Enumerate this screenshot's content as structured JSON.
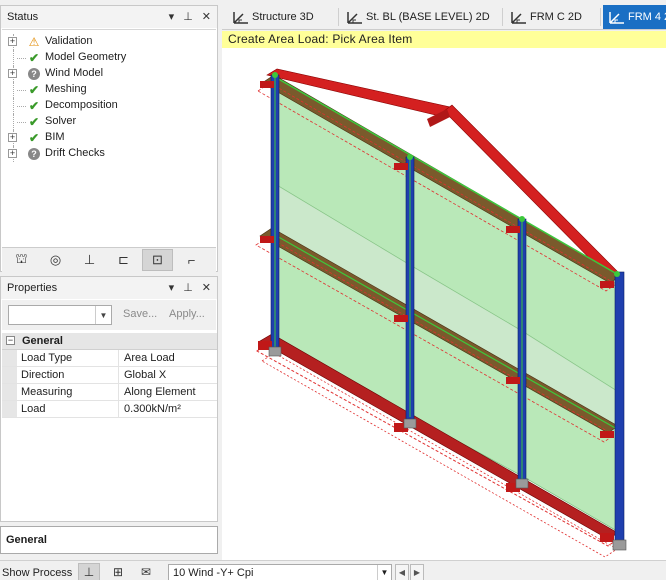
{
  "status_panel": {
    "title": "Status",
    "items": [
      {
        "label": "Validation",
        "state": "warning",
        "expandable": true
      },
      {
        "label": "Model Geometry",
        "state": "ok",
        "expandable": false
      },
      {
        "label": "Wind Model",
        "state": "unknown",
        "expandable": true
      },
      {
        "label": "Meshing",
        "state": "ok",
        "expandable": false
      },
      {
        "label": "Decomposition",
        "state": "ok",
        "expandable": false
      },
      {
        "label": "Solver",
        "state": "ok",
        "expandable": false
      },
      {
        "label": "BIM",
        "state": "ok",
        "expandable": true
      },
      {
        "label": "Drift Checks",
        "state": "unknown",
        "expandable": true
      }
    ]
  },
  "properties_panel": {
    "title": "Properties",
    "save_label": "Save...",
    "apply_label": "Apply...",
    "category": "General",
    "rows": [
      {
        "key": "Load Type",
        "value": "Area Load"
      },
      {
        "key": "Direction",
        "value": "Global X"
      },
      {
        "key": "Measuring",
        "value": "Along Element"
      },
      {
        "key": "Load",
        "value": "0.300kN/m²"
      }
    ]
  },
  "general_panel": {
    "title": "General"
  },
  "status_bar": {
    "show_process_label": "Show Process",
    "loadcase_value": "10 Wind -Y+ Cpi"
  },
  "tabs": [
    {
      "label": "Structure 3D",
      "active": false
    },
    {
      "label": "St. BL (BASE LEVEL) 2D",
      "active": false
    },
    {
      "label": "FRM C 2D",
      "active": false
    },
    {
      "label": "FRM 4 2",
      "active": true
    }
  ],
  "viewport": {
    "prompt": "Create Area Load: Pick Area Item"
  },
  "colors": {
    "accent_tab": "#1a6fc4",
    "prompt_bg": "#ffff99",
    "panel_fill": "#b9e8b8",
    "column_blue": "#1f3fae",
    "beam_red": "#d42020"
  }
}
